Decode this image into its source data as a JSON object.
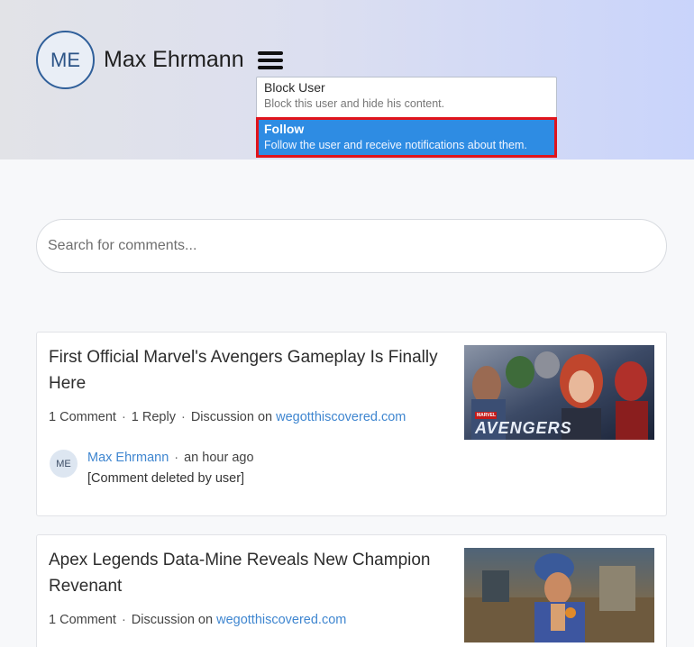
{
  "profile": {
    "initials": "ME",
    "name": "Max Ehrmann"
  },
  "menu": {
    "items": [
      {
        "title": "Block User",
        "description": "Block this user and hide his content."
      },
      {
        "title": "Follow",
        "description": "Follow the user and receive notifications about them."
      }
    ]
  },
  "search": {
    "placeholder": "Search for comments..."
  },
  "separator": "·",
  "posts": [
    {
      "title": "First Official Marvel's Avengers Gameplay Is Finally Here",
      "comments": "1 Comment",
      "replies": "1 Reply",
      "discussion_prefix": "Discussion on",
      "source": "wegotthiscovered.com",
      "thumb_text": "AVENGERS",
      "thumb_brand": "MARVEL",
      "comment": {
        "initials": "ME",
        "author": "Max Ehrmann",
        "time": "an hour ago",
        "text": "[Comment deleted by user]"
      }
    },
    {
      "title": "Apex Legends Data-Mine Reveals New Champion Revenant",
      "comments": "1 Comment",
      "discussion_prefix": "Discussion on",
      "source": "wegotthiscovered.com"
    }
  ],
  "colors": {
    "accent": "#2e8ce3",
    "highlight_border": "#e0141c",
    "link": "#3f86d0"
  }
}
